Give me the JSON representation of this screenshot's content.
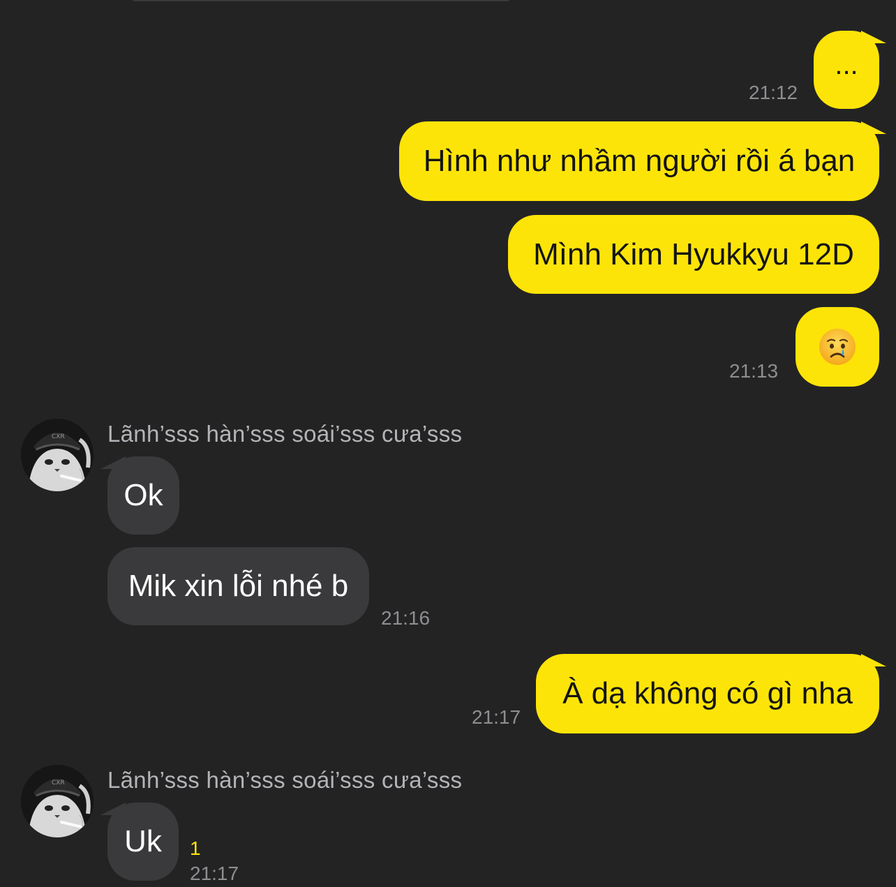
{
  "messages": {
    "m1": {
      "text": "...",
      "time": "21:12"
    },
    "m2": {
      "text": "Hình như nhầm người rồi á bạn"
    },
    "m3": {
      "text": "Mình Kim Hyukkyu 12D"
    },
    "m4": {
      "emoji": "crying-face",
      "time": "21:13"
    },
    "m5": {
      "sender": "Lãnh’sss hàn’sss soái’sss cưa’sss",
      "text": "Ok"
    },
    "m6": {
      "text": "Mik xin lỗi nhé b",
      "time": "21:16"
    },
    "m7": {
      "text": "À dạ không có gì nha",
      "time": "21:17"
    },
    "m8": {
      "sender": "Lãnh’sss hàn’sss soái’sss cưa’sss",
      "text": "Uk",
      "unread": "1",
      "time": "21:17"
    }
  },
  "colors": {
    "background": "#232324",
    "outgoing_bubble": "#fde408",
    "incoming_bubble": "#3a3a3c",
    "timestamp": "#8e8e92",
    "unread_count": "#fde408"
  }
}
